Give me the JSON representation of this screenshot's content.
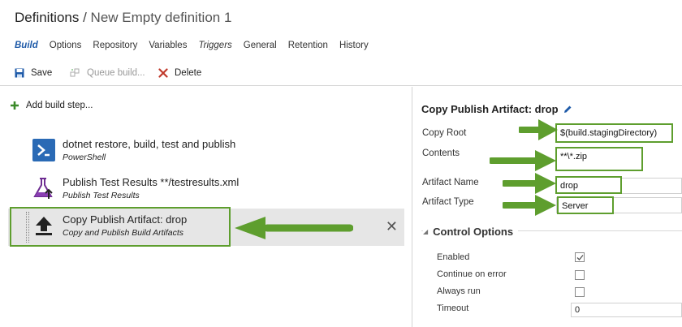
{
  "header": {
    "breadcrumb_root": "Definitions",
    "separator": " / ",
    "definition_name": "New Empty definition 1"
  },
  "tabs": [
    {
      "label": "Build",
      "active": true
    },
    {
      "label": "Options"
    },
    {
      "label": "Repository"
    },
    {
      "label": "Variables"
    },
    {
      "label": "Triggers",
      "italic": true
    },
    {
      "label": "General"
    },
    {
      "label": "Retention"
    },
    {
      "label": "History"
    }
  ],
  "toolbar": {
    "save_label": "Save",
    "queue_label": "Queue build...",
    "delete_label": "Delete"
  },
  "steps_panel": {
    "add_step_label": "Add build step...",
    "steps": [
      {
        "name": "dotnet restore, build, test and publish",
        "description": "PowerShell",
        "icon": "powershell-icon"
      },
      {
        "name": "Publish Test Results **/testresults.xml",
        "description": "Publish Test Results",
        "icon": "flask-icon"
      },
      {
        "name": "Copy Publish Artifact: drop",
        "description": "Copy and Publish Build Artifacts",
        "icon": "upload-icon",
        "selected": true
      }
    ]
  },
  "details": {
    "title": "Copy Publish Artifact: drop",
    "fields": {
      "copy_root_label": "Copy Root",
      "copy_root_value": "$(build.stagingDirectory)",
      "contents_label": "Contents",
      "contents_value": "**\\*.zip",
      "artifact_name_label": "Artifact Name",
      "artifact_name_value": "drop",
      "artifact_type_label": "Artifact Type",
      "artifact_type_value": "Server"
    },
    "control_options": {
      "title": "Control Options",
      "enabled_label": "Enabled",
      "enabled": true,
      "continue_label": "Continue on error",
      "continue": false,
      "always_run_label": "Always run",
      "always_run": false,
      "timeout_label": "Timeout",
      "timeout_value": "0"
    }
  },
  "colors": {
    "accent": "#1e5aa8",
    "highlight": "#5e9e2e",
    "delete": "#c0392b",
    "add": "#3b8a2a"
  }
}
